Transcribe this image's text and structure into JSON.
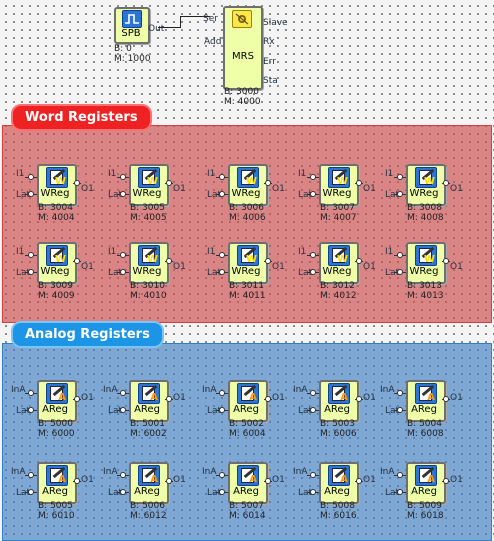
{
  "spb": {
    "name": "SPB",
    "out_port": "Out",
    "b": "B: 0",
    "m": "M: 1000"
  },
  "mrs": {
    "name": "MRS",
    "in_ports": [
      "Ser",
      "Add"
    ],
    "out_ports": [
      "Slave",
      "Rx",
      "Err",
      "Sta"
    ],
    "b": "B: 3000",
    "m": "M: 4000"
  },
  "word_group": {
    "title": "Word Registers",
    "color": "#ee2222"
  },
  "analog_group": {
    "title": "Analog Registers",
    "color": "#1c95e6"
  },
  "word_blocks": [
    {
      "name": "WReg",
      "in1": "I1",
      "in2": "Lat",
      "out": "O1",
      "b": "B: 3004",
      "m": "M: 4004"
    },
    {
      "name": "WReg",
      "in1": "I1",
      "in2": "Lat",
      "out": "O1",
      "b": "B: 3005",
      "m": "M: 4005"
    },
    {
      "name": "WReg",
      "in1": "I1",
      "in2": "Lat",
      "out": "O1",
      "b": "B: 3006",
      "m": "M: 4006"
    },
    {
      "name": "WReg",
      "in1": "I1",
      "in2": "Lat",
      "out": "O1",
      "b": "B: 3007",
      "m": "M: 4007"
    },
    {
      "name": "WReg",
      "in1": "I1",
      "in2": "Lat",
      "out": "O1",
      "b": "B: 3008",
      "m": "M: 4008"
    },
    {
      "name": "WReg",
      "in1": "I1",
      "in2": "Lat",
      "out": "O1",
      "b": "B: 3009",
      "m": "M: 4009"
    },
    {
      "name": "WReg",
      "in1": "I1",
      "in2": "Lat",
      "out": "O1",
      "b": "B: 3010",
      "m": "M: 4010"
    },
    {
      "name": "WReg",
      "in1": "I1",
      "in2": "Lat",
      "out": "O1",
      "b": "B: 3011",
      "m": "M: 4011"
    },
    {
      "name": "WReg",
      "in1": "I1",
      "in2": "Lat",
      "out": "O1",
      "b": "B: 3012",
      "m": "M: 4012"
    },
    {
      "name": "WReg",
      "in1": "I1",
      "in2": "Lat",
      "out": "O1",
      "b": "B: 3013",
      "m": "M: 4013"
    }
  ],
  "analog_blocks": [
    {
      "name": "AReg",
      "in1": "InA",
      "in2": "Lat",
      "out": "O1",
      "b": "B: 5000",
      "m": "M: 6000"
    },
    {
      "name": "AReg",
      "in1": "InA",
      "in2": "Lat",
      "out": "O1",
      "b": "B: 5001",
      "m": "M: 6002"
    },
    {
      "name": "AReg",
      "in1": "InA",
      "in2": "Lat",
      "out": "O1",
      "b": "B: 5002",
      "m": "M: 6004"
    },
    {
      "name": "AReg",
      "in1": "InA",
      "in2": "Lat",
      "out": "O1",
      "b": "B: 5003",
      "m": "M: 6006"
    },
    {
      "name": "AReg",
      "in1": "InA",
      "in2": "Lat",
      "out": "O1",
      "b": "B: 5004",
      "m": "M: 6008"
    },
    {
      "name": "AReg",
      "in1": "InA",
      "in2": "Lat",
      "out": "O1",
      "b": "B: 5005",
      "m": "M: 6010"
    },
    {
      "name": "AReg",
      "in1": "InA",
      "in2": "Lat",
      "out": "O1",
      "b": "B: 5006",
      "m": "M: 6012"
    },
    {
      "name": "AReg",
      "in1": "InA",
      "in2": "Lat",
      "out": "O1",
      "b": "B: 5007",
      "m": "M: 6014"
    },
    {
      "name": "AReg",
      "in1": "InA",
      "in2": "Lat",
      "out": "O1",
      "b": "B: 5008",
      "m": "M: 6016"
    },
    {
      "name": "AReg",
      "in1": "InA",
      "in2": "Lat",
      "out": "O1",
      "b": "B: 5009",
      "m": "M: 6018"
    }
  ]
}
